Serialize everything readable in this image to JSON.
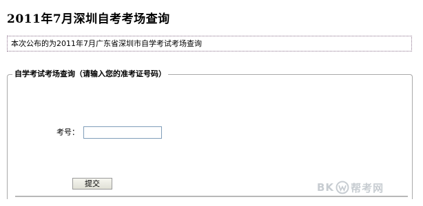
{
  "page": {
    "title": "2011年7月深圳自考考场查询",
    "notice": "本次公布的为2011年7月广东省深圳市自学考试考场查询"
  },
  "form": {
    "legend": "自学考试考场查询（请输入您的准考证号码）",
    "exam_number_label": "考号：",
    "exam_number_value": "",
    "submit_label": "提交"
  },
  "watermark": {
    "prefix": "BK",
    "suffix": "帮考网",
    "logo_icon": "bkw-logo-icon"
  }
}
